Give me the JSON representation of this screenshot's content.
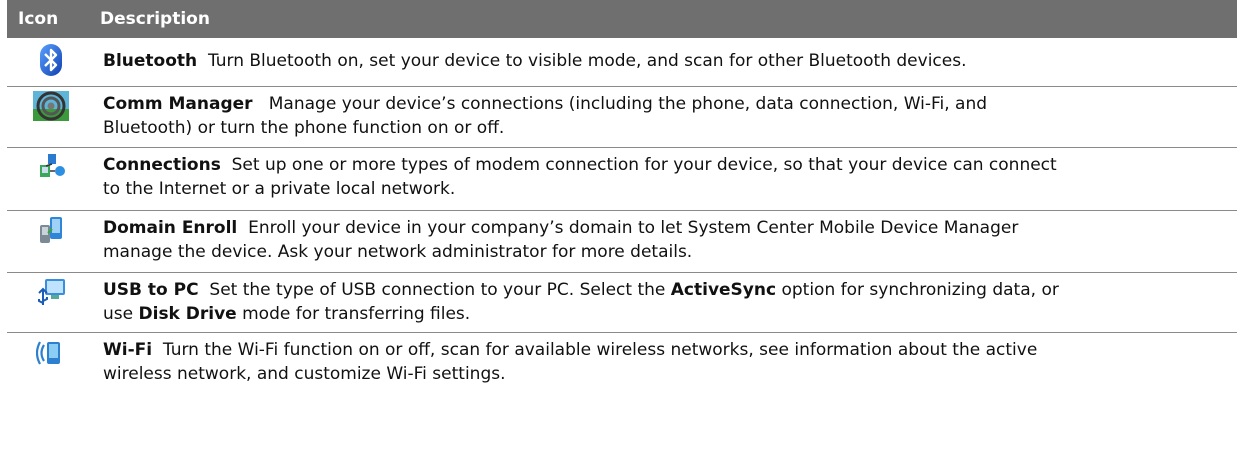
{
  "header": {
    "icon_col": "Icon",
    "desc_col": "Description"
  },
  "rows": [
    {
      "icon": "bluetooth-icon",
      "title": "Bluetooth",
      "text": "Turn Bluetooth on, set your device to visible mode, and scan for other Bluetooth devices."
    },
    {
      "icon": "comm-manager-icon",
      "title": "Comm Manager",
      "text_line1": "Manage your device’s connections (including the phone, data connection, Wi-Fi, and",
      "text_line2": "Bluetooth) or turn the phone function on or off."
    },
    {
      "icon": "connections-icon",
      "title": "Connections",
      "text_line1": "Set up one or more types of modem connection for your device, so that your device can connect",
      "text_line2": "to the Internet or a private local network."
    },
    {
      "icon": "domain-enroll-icon",
      "title": "Domain Enroll",
      "text_line1": "Enroll your device in your company’s domain to let System Center Mobile Device Manager",
      "text_line2": "manage the device. Ask your network administrator for more details."
    },
    {
      "icon": "usb-to-pc-icon",
      "title": "USB to PC",
      "text_a": "Set the type of USB connection to your PC. Select the ",
      "bold_a": "ActiveSync",
      "text_b": " option for synchronizing data, or",
      "text_c": "use ",
      "bold_b": "Disk Drive",
      "text_d": " mode for transferring files."
    },
    {
      "icon": "wifi-icon",
      "title": "Wi-Fi",
      "text_line1": "Turn the Wi-Fi function on or off, scan for available wireless networks, see information about the active",
      "text_line2": "wireless network, and customize Wi-Fi settings."
    }
  ],
  "colors": {
    "header_bg": "#6f6f6f",
    "rule": "#8a8a8a",
    "bluetooth_blue": "#1e5fd0"
  }
}
